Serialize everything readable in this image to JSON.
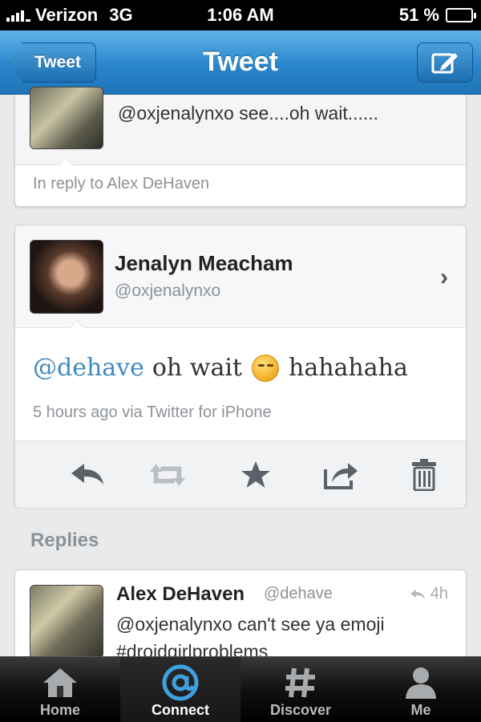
{
  "status_bar": {
    "carrier": "Verizon",
    "network": "3G",
    "time": "1:06 AM",
    "battery": "51 %",
    "battery_level": 0.51
  },
  "nav_bar": {
    "back_label": "Tweet",
    "title": "Tweet",
    "compose_icon": "compose-icon"
  },
  "previous_tweet": {
    "text": "@oxjenalynxo see....oh wait......",
    "reply_context": "In reply to Alex DeHaven"
  },
  "main_tweet": {
    "name": "Jenalyn Meacham",
    "handle": "@oxjenalynxo",
    "mention": "@dehave",
    "text_before_emoji": "oh wait",
    "text_after_emoji": "hahahaha",
    "meta": "5 hours ago via Twitter for iPhone",
    "actions": [
      "reply-icon",
      "retweet-icon",
      "favorite-icon",
      "share-icon",
      "delete-icon"
    ]
  },
  "replies": {
    "label": "Replies",
    "items": [
      {
        "name": "Alex DeHaven",
        "handle": "@dehave",
        "time": "4h",
        "line1": "@oxjenalynxo can't see ya emoji",
        "line2": "#droidgirlproblems"
      }
    ]
  },
  "tab_bar": {
    "tabs": [
      {
        "label": "Home",
        "icon": "home-icon"
      },
      {
        "label": "Connect",
        "icon": "at-icon"
      },
      {
        "label": "Discover",
        "icon": "hash-icon"
      },
      {
        "label": "Me",
        "icon": "person-icon"
      }
    ],
    "active": "Connect"
  },
  "colors": {
    "nav_blue": "#2a86cc",
    "link_blue": "#3f8ac1",
    "connect_blue": "#3fa0e0"
  }
}
